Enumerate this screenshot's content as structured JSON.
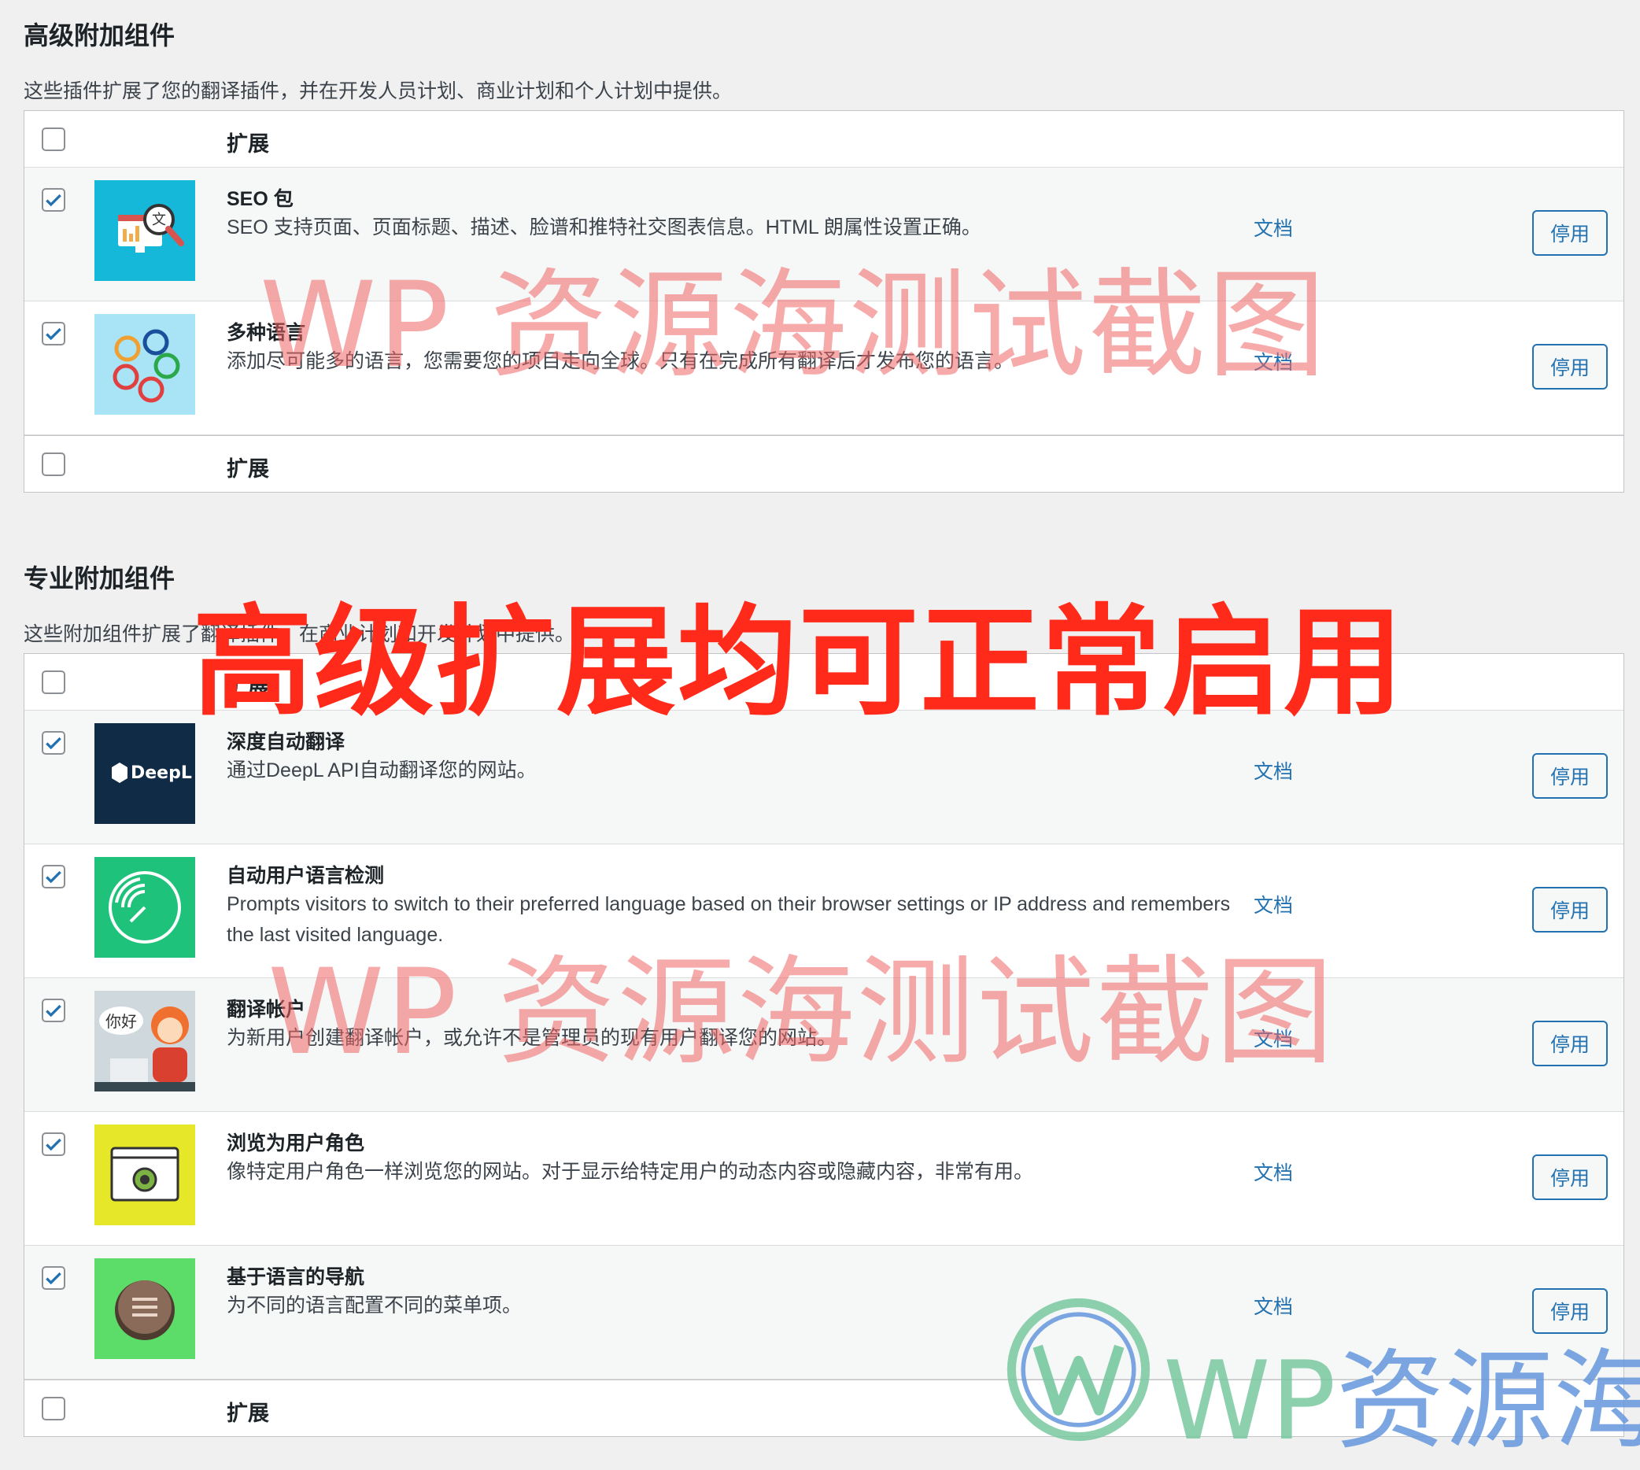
{
  "premium": {
    "title": "高级附加组件",
    "description": "这些插件扩展了您的翻译插件，并在开发人员计划、商业计划和个人计划中提供。",
    "column_label": "扩展",
    "footer_label": "扩展",
    "items": [
      {
        "name": "SEO 包",
        "description": "SEO 支持页面、页面标题、描述、脸谱和推特社交图表信息。HTML 朗属性设置正确。",
        "doc_link": "文档",
        "button": "停用",
        "checked": true,
        "icon": "seo-magnifier-icon"
      },
      {
        "name": "多种语言",
        "description": "添加尽可能多的语言，您需要您的项目走向全球。只有在完成所有翻译后才发布您的语言。",
        "doc_link": "文档",
        "button": "停用",
        "checked": true,
        "icon": "language-bubbles-icon"
      }
    ]
  },
  "pro": {
    "title": "专业附加组件",
    "description": "这些附加组件扩展了翻译插件，在商业计划和开发计划中提供。",
    "column_label": "扩展",
    "footer_label": "扩展",
    "items": [
      {
        "name": "深度自动翻译",
        "description": "通过DeepL API自动翻译您的网站。",
        "doc_link": "文档",
        "button": "停用",
        "checked": true,
        "icon": "deepl-logo-icon",
        "logo_text": "DeepL"
      },
      {
        "name": "自动用户语言检测",
        "description": "Prompts visitors to switch to their preferred language based on their browser settings or IP address and remembers the last visited language.",
        "doc_link": "文档",
        "button": "停用",
        "checked": true,
        "icon": "radar-icon"
      },
      {
        "name": "翻译帐户",
        "description": "为新用户创建翻译帐户，或允许不是管理员的现有用户翻译您的网站。",
        "doc_link": "文档",
        "button": "停用",
        "checked": true,
        "icon": "translator-avatar-icon",
        "bubble_text": "你好"
      },
      {
        "name": "浏览为用户角色",
        "description": "像特定用户角色一样浏览您的网站。对于显示给特定用户的动态内容或隐藏内容，非常有用。",
        "doc_link": "文档",
        "button": "停用",
        "checked": true,
        "icon": "eye-window-icon"
      },
      {
        "name": "基于语言的导航",
        "description": "为不同的语言配置不同的菜单项。",
        "doc_link": "文档",
        "button": "停用",
        "checked": true,
        "icon": "menu-circle-icon"
      }
    ]
  },
  "overlays": {
    "watermark_top": "WP 资源海测试截图",
    "watermark_bottom": "WP 资源海测试截图",
    "caption": "高级扩展均可正常启用",
    "logo_text_a": "WP",
    "logo_text_b": "资源海"
  },
  "colors": {
    "accent": "#2271b1",
    "caption": "#ff2a1a",
    "watermark": "#f06464"
  }
}
